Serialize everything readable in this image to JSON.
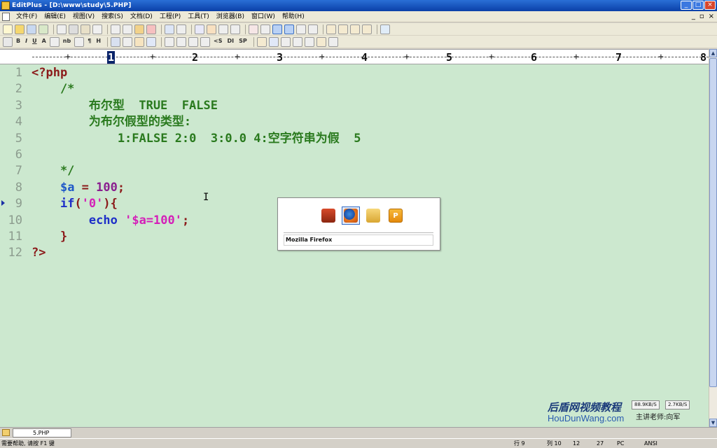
{
  "window": {
    "title": "EditPlus - [D:\\www\\study\\5.PHP]"
  },
  "menu": [
    "文件(F)",
    "编辑(E)",
    "视图(V)",
    "搜索(S)",
    "文档(D)",
    "工程(P)",
    "工具(T)",
    "浏览器(B)",
    "窗口(W)",
    "帮助(H)"
  ],
  "window_buttons": {
    "minimize": "_",
    "maximize": "□",
    "close": "×"
  },
  "mdi_buttons": {
    "minimize": "_",
    "restore": "▫",
    "close": "×"
  },
  "toolbar2_text": [
    "B",
    "I",
    "U",
    "A",
    "nb",
    "¶",
    "H",
    "<S",
    "DI",
    "SP"
  ],
  "ruler": {
    "current": "1",
    "numbers": [
      "1",
      "2",
      "3",
      "4",
      "5",
      "6",
      "7",
      "8"
    ]
  },
  "code_lines": [
    {
      "n": "1",
      "parts": [
        {
          "t": "<?php",
          "c": "kw-php"
        }
      ]
    },
    {
      "n": "2",
      "parts": [
        {
          "t": "    /*",
          "c": "cmt"
        }
      ]
    },
    {
      "n": "3",
      "parts": [
        {
          "t": "        布尔型  TRUE  FALSE",
          "c": "cmt"
        }
      ]
    },
    {
      "n": "4",
      "parts": [
        {
          "t": "        为布尔假型的类型:",
          "c": "cmt"
        }
      ]
    },
    {
      "n": "5",
      "parts": [
        {
          "t": "            1:FALSE 2:0  3:0.0 4:空字符串为假  5",
          "c": "cmt"
        }
      ]
    },
    {
      "n": "6",
      "parts": []
    },
    {
      "n": "7",
      "parts": [
        {
          "t": "    */",
          "c": "cmt"
        }
      ]
    },
    {
      "n": "8",
      "parts": [
        {
          "t": "    ",
          "c": ""
        },
        {
          "t": "$a",
          "c": "var"
        },
        {
          "t": " = ",
          "c": "op"
        },
        {
          "t": "100",
          "c": "num-lit"
        },
        {
          "t": ";",
          "c": "op"
        }
      ]
    },
    {
      "n": "9",
      "parts": [
        {
          "t": "    ",
          "c": ""
        },
        {
          "t": "if",
          "c": "kw"
        },
        {
          "t": "(",
          "c": "brace"
        },
        {
          "t": "'0'",
          "c": "str"
        },
        {
          "t": "){",
          "c": "brace"
        }
      ]
    },
    {
      "n": "10",
      "parts": [
        {
          "t": "        ",
          "c": ""
        },
        {
          "t": "echo",
          "c": "kw"
        },
        {
          "t": " ",
          "c": ""
        },
        {
          "t": "'$a=100'",
          "c": "str"
        },
        {
          "t": ";",
          "c": "op"
        }
      ]
    },
    {
      "n": "11",
      "parts": [
        {
          "t": "    }",
          "c": "brace"
        }
      ]
    },
    {
      "n": "12",
      "parts": [
        {
          "t": "?>",
          "c": "kw-php"
        }
      ]
    }
  ],
  "switcher": {
    "selected_app": "Mozilla Firefox",
    "icons": [
      "house-icon",
      "firefox-icon",
      "folder-icon",
      "p-app-icon"
    ]
  },
  "watermark": {
    "brand_cn": "后盾网视频教程",
    "url": "HouDunWang.com",
    "teacher": "主讲老师:向军"
  },
  "network": {
    "download": "88.9KB/S",
    "upload": "2.7KB/S"
  },
  "tabs": [
    {
      "label": "5.PHP"
    }
  ],
  "status": {
    "help": "需要帮助, 请按 F1 键",
    "line": "行 9",
    "col": "列 10",
    "lines": "12",
    "chars": "27",
    "mode": "PC",
    "encoding": "ANSI"
  }
}
